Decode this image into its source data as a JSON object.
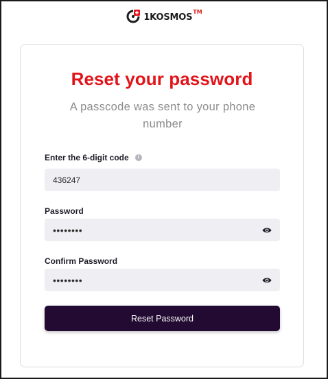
{
  "brand": {
    "logo_text": "1KOSMOS",
    "trademark": "TM",
    "accent_color": "#e2141a",
    "logo_mark_icon": "1kosmos-logo-icon"
  },
  "form": {
    "title": "Reset your password",
    "subtitle": "A passcode was sent to your phone number",
    "code": {
      "label": "Enter the 6-digit code",
      "info_icon": "info-icon",
      "value": "436247"
    },
    "password": {
      "label": "Password",
      "value": "12345678",
      "toggle_icon": "eye-icon"
    },
    "confirm_password": {
      "label": "Confirm Password",
      "value": "12345678",
      "toggle_icon": "eye-icon"
    },
    "submit_label": "Reset Password",
    "button_color": "#220a32",
    "field_bg_color": "#efeef2"
  }
}
